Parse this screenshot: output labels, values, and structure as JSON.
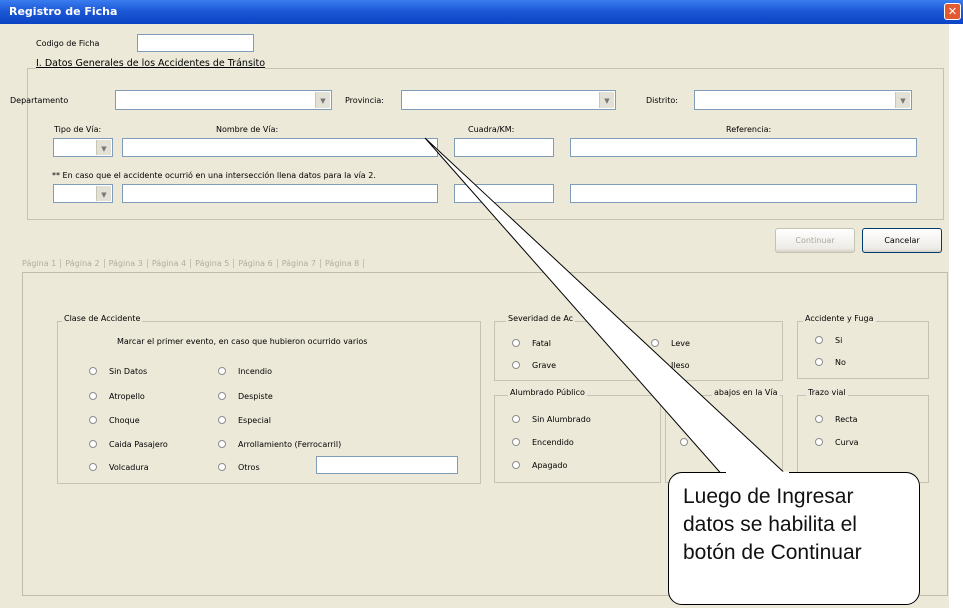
{
  "window": {
    "title": "Registro de Ficha",
    "close_glyph": "✕"
  },
  "form": {
    "codigo_label": "Codigo de Ficha",
    "section1_title": "I. Datos Generales de los Accidentes de Tránsito",
    "departamento_label": "Departamento",
    "provincia_label": "Provincia:",
    "distrito_label": "Distrito:",
    "tipo_via_label": "Tipo de Vía:",
    "nombre_via_label": "Nombre de Vía:",
    "cuadra_label": "Cuadra/KM:",
    "referencia_label": "Referencia:",
    "interseccion_note": "** En caso que el accidente ocurrió en una intersección llena datos para la vía 2."
  },
  "buttons": {
    "continuar": "Continuar",
    "cancelar": "Cancelar"
  },
  "tabs": [
    "Página 1",
    "Página 2",
    "Página 3",
    "Página 4",
    "Página 5",
    "Página 6",
    "Página 7",
    "Página 8"
  ],
  "clase": {
    "title": "Clase de Accidente",
    "instruction": "Marcar el primer evento, en caso que hubieron ocurrido varios",
    "col1": [
      "Sin Datos",
      "Atropello",
      "Choque",
      "Caida Pasajero",
      "Volcadura"
    ],
    "col2": [
      "Incendio",
      "Despiste",
      "Especial",
      "Arrollamiento (Ferrocarril)",
      "Otros"
    ]
  },
  "severidad": {
    "title": "Severidad de Ac",
    "options": [
      "Fatal",
      "Grave",
      "Leve",
      "Ileso"
    ]
  },
  "alumbrado": {
    "title": "Alumbrado Público",
    "options": [
      "Sin Alumbrado",
      "Encendido",
      "Apagado"
    ]
  },
  "trabajos": {
    "title": "abajos en la Vía"
  },
  "fuga": {
    "title": "Accidente y Fuga",
    "options": [
      "Si",
      "No"
    ]
  },
  "trazo": {
    "title": "Trazo vial",
    "options": [
      "Recta",
      "Curva"
    ]
  },
  "callout": {
    "lines": [
      "Luego de Ingresar",
      "datos se habilita el",
      "botón de Continuar"
    ]
  }
}
